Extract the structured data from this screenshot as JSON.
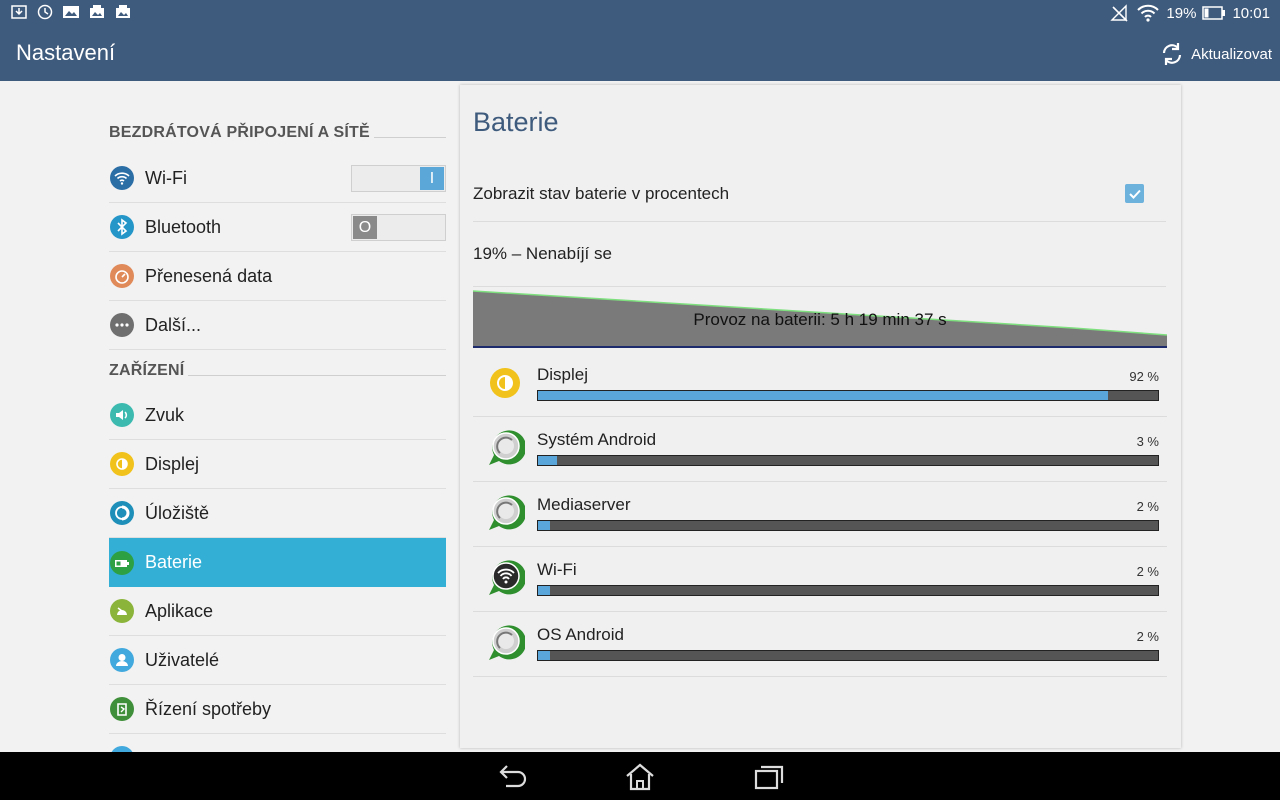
{
  "statusbar": {
    "battery_percent": "19%",
    "time": "10:01"
  },
  "appbar": {
    "title": "Nastavení",
    "refresh_label": "Aktualizovat"
  },
  "sections": {
    "wireless": "BEZDRÁTOVÁ PŘIPOJENÍ A SÍTĚ",
    "device": "ZAŘÍZENÍ"
  },
  "wireless_items": [
    {
      "label": "Wi-Fi",
      "toggle": "I",
      "toggle_state": "on"
    },
    {
      "label": "Bluetooth",
      "toggle": "O",
      "toggle_state": "off"
    },
    {
      "label": "Přenesená data"
    },
    {
      "label": "Další..."
    }
  ],
  "device_items": [
    {
      "label": "Zvuk"
    },
    {
      "label": "Displej"
    },
    {
      "label": "Úložiště"
    },
    {
      "label": "Baterie",
      "selected": true
    },
    {
      "label": "Aplikace"
    },
    {
      "label": "Uživatelé"
    },
    {
      "label": "Řízení spotřeby"
    }
  ],
  "panel": {
    "title": "Baterie",
    "show_percent_label": "Zobrazit stav baterie v procentech",
    "show_percent_checked": true,
    "status": "19% – Nenabíjí se",
    "graph_label": "Provoz na baterii: 5 h 19 min 37 s"
  },
  "usage": [
    {
      "name": "Displej",
      "pct_label": "92 %",
      "pct": 92,
      "icon": "display-brightness-icon"
    },
    {
      "name": "Systém Android",
      "pct_label": "3 %",
      "pct": 3,
      "icon": "android-system-icon"
    },
    {
      "name": "Mediaserver",
      "pct_label": "2 %",
      "pct": 2,
      "icon": "android-system-icon"
    },
    {
      "name": "Wi-Fi",
      "pct_label": "2 %",
      "pct": 2,
      "icon": "wifi-icon"
    },
    {
      "name": "OS Android",
      "pct_label": "2 %",
      "pct": 2,
      "icon": "android-system-icon"
    }
  ],
  "colors": {
    "appbar": "#3e5a7c",
    "selected": "#33afd6",
    "bar_fill": "#5aa5da",
    "graph_fill": "#7a7a7a",
    "graph_line": "#7fe07f"
  }
}
